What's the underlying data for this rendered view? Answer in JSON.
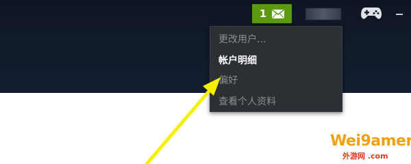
{
  "toolbar": {
    "notification_count": "1",
    "envelope_icon": "envelope-icon",
    "controller_icon": "gamepad-icon",
    "minimize_icon": "minimize-icon"
  },
  "account_menu": {
    "items": [
      {
        "label": "更改用户...",
        "style": "dim"
      },
      {
        "label": "帐户明细",
        "style": "bold"
      },
      {
        "label": "偏好",
        "style": "dim"
      },
      {
        "label": "查看个人资料",
        "style": "dim"
      }
    ]
  },
  "annotation": {
    "arrow_color": "#f5f000"
  },
  "watermark": {
    "main": "Wei9amer",
    "sub": "外游网 .com"
  },
  "colors": {
    "topbar": "#111a2a",
    "notif_bg": "#5b9a0f",
    "menu_bg": "#2c2f34",
    "watermark_main": "#f0a010",
    "watermark_sub": "#e03a1a"
  }
}
